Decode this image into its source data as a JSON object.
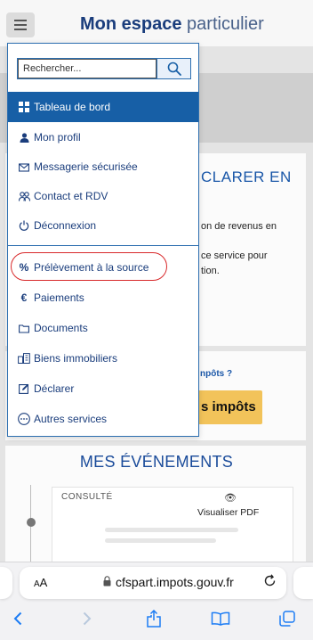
{
  "header": {
    "title_bold": "Mon espace",
    "title_light": " particulier",
    "menu_icon": "hamburger-icon"
  },
  "menu": {
    "search": {
      "placeholder": "Rechercher...",
      "value": "",
      "icon": "search-icon"
    },
    "items": [
      {
        "label": "Tableau de bord",
        "icon": "grid-icon",
        "active": true
      },
      {
        "label": "Mon profil",
        "icon": "user-icon"
      },
      {
        "label": "Messagerie sécurisée",
        "icon": "envelope-icon"
      },
      {
        "label": "Contact et RDV",
        "icon": "people-icon"
      },
      {
        "label": "Déconnexion",
        "icon": "power-icon"
      },
      {
        "label": "Prélèvement à la source",
        "icon": "percent-icon",
        "highlighted": true
      },
      {
        "label": "Paiements",
        "icon": "euro-icon"
      },
      {
        "label": "Documents",
        "icon": "folder-icon"
      },
      {
        "label": "Biens immobiliers",
        "icon": "buildings-icon"
      },
      {
        "label": "Déclarer",
        "icon": "edit-icon"
      },
      {
        "label": "Autres services",
        "icon": "more-icon"
      }
    ]
  },
  "background": {
    "card1_title": "CLARER EN",
    "card1_line1": "on de revenus en",
    "card1_line2": "ce service pour",
    "card1_line3": "tion.",
    "card2_question": "npôts ?",
    "card2_button": "s impôts",
    "events_title": "MES ÉVÉNEMENTS",
    "event_status": "CONSULTÉ",
    "event_view": "Visualiser",
    "event_pdf": "PDF"
  },
  "browser": {
    "text_size": "AA",
    "url": "cfspart.impots.gouv.fr",
    "reload_icon": "reload-icon",
    "toolbar": [
      "back-icon",
      "forward-icon",
      "share-icon",
      "bookmarks-icon",
      "tabs-icon"
    ]
  },
  "colors": {
    "brand": "#1a3d7c",
    "active_item": "#175fa6",
    "highlight": "#d8292b",
    "accent_button": "#f2c35a",
    "safari_blue": "#1c7cf4"
  }
}
